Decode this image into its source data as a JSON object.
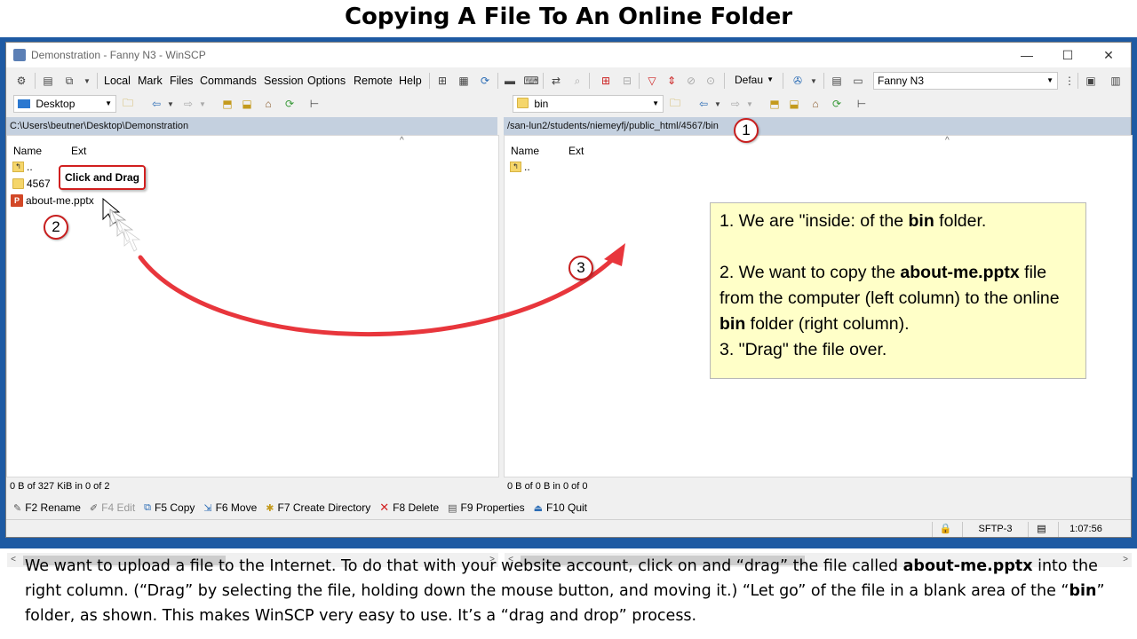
{
  "slide": {
    "title": "Copying A File To An Online Folder",
    "body_parts": [
      "We want to upload a file to the Internet. To do that with your website account, click on and “drag” the file called ",
      "about-me.pptx",
      " into the right column. (“Drag” by selecting the file, holding down the mouse button, and moving it.) “Let go” of the file in a blank area of the “",
      "bin",
      "” folder, as shown.  This makes WinSCP very easy to use. It’s a “drag and drop” process."
    ]
  },
  "window": {
    "title": "Demonstration - Fanny N3 - WinSCP",
    "controls": {
      "minimize": "—",
      "maximize": "☐",
      "close": "✕"
    }
  },
  "menu": [
    "Local",
    "Mark",
    "Files",
    "Commands",
    "Session",
    "Options",
    "Remote",
    "Help"
  ],
  "toolbar": {
    "transfer_preset": "Defau",
    "session_name": "Fanny N3",
    "left_location": "Desktop",
    "right_location": "bin"
  },
  "left_panel": {
    "path": "C:\\Users\\beutner\\Desktop\\Demonstration",
    "columns": [
      "Name",
      "Ext"
    ],
    "files": [
      {
        "name": "..",
        "type": "updir"
      },
      {
        "name": "4567",
        "type": "folder"
      },
      {
        "name": "about-me.pptx",
        "type": "pptx"
      }
    ],
    "status": "0 B of 327 KiB in 0 of 2"
  },
  "right_panel": {
    "path": "/san-lun2/students/niemeyfj/public_html/4567/bin",
    "columns": [
      "Name",
      "Ext"
    ],
    "files": [
      {
        "name": "..",
        "type": "updir"
      }
    ],
    "status": "0 B of 0 B in 0 of 0"
  },
  "function_keys": [
    {
      "label": "F2 Rename",
      "icon": "rename-icon",
      "disabled": false
    },
    {
      "label": "F4 Edit",
      "icon": "edit-icon",
      "disabled": true
    },
    {
      "label": "F5 Copy",
      "icon": "copy-icon",
      "disabled": false
    },
    {
      "label": "F6 Move",
      "icon": "move-icon",
      "disabled": false
    },
    {
      "label": "F7 Create Directory",
      "icon": "new-folder-icon",
      "disabled": false
    },
    {
      "label": "F8 Delete",
      "icon": "delete-icon",
      "disabled": false
    },
    {
      "label": "F9 Properties",
      "icon": "properties-icon",
      "disabled": false
    },
    {
      "label": "F10 Quit",
      "icon": "quit-icon",
      "disabled": false
    }
  ],
  "statusbar": {
    "protocol": "SFTP-3",
    "elapsed": "1:07:56"
  },
  "annotations": {
    "drag_label": "Click and Drag",
    "badges": [
      "1",
      "2",
      "3"
    ],
    "note": {
      "line1_pre": "1. We are \"inside: of the ",
      "line1_bold": "bin",
      "line1_post": " folder.",
      "line2_pre": "2. We want to copy the ",
      "line2_bold": "about-me.pptx",
      "line2_post": " file",
      "line3": "from the computer (left column) to the online",
      "line4_bold": "bin",
      "line4_post": " folder (right column).",
      "line5": "3. \"Drag\" the file over."
    }
  },
  "colors": {
    "frame": "#1e5aa3",
    "accent_red": "#e8363c",
    "note_bg": "#ffffc8",
    "path_bar": "#c4d0df"
  }
}
